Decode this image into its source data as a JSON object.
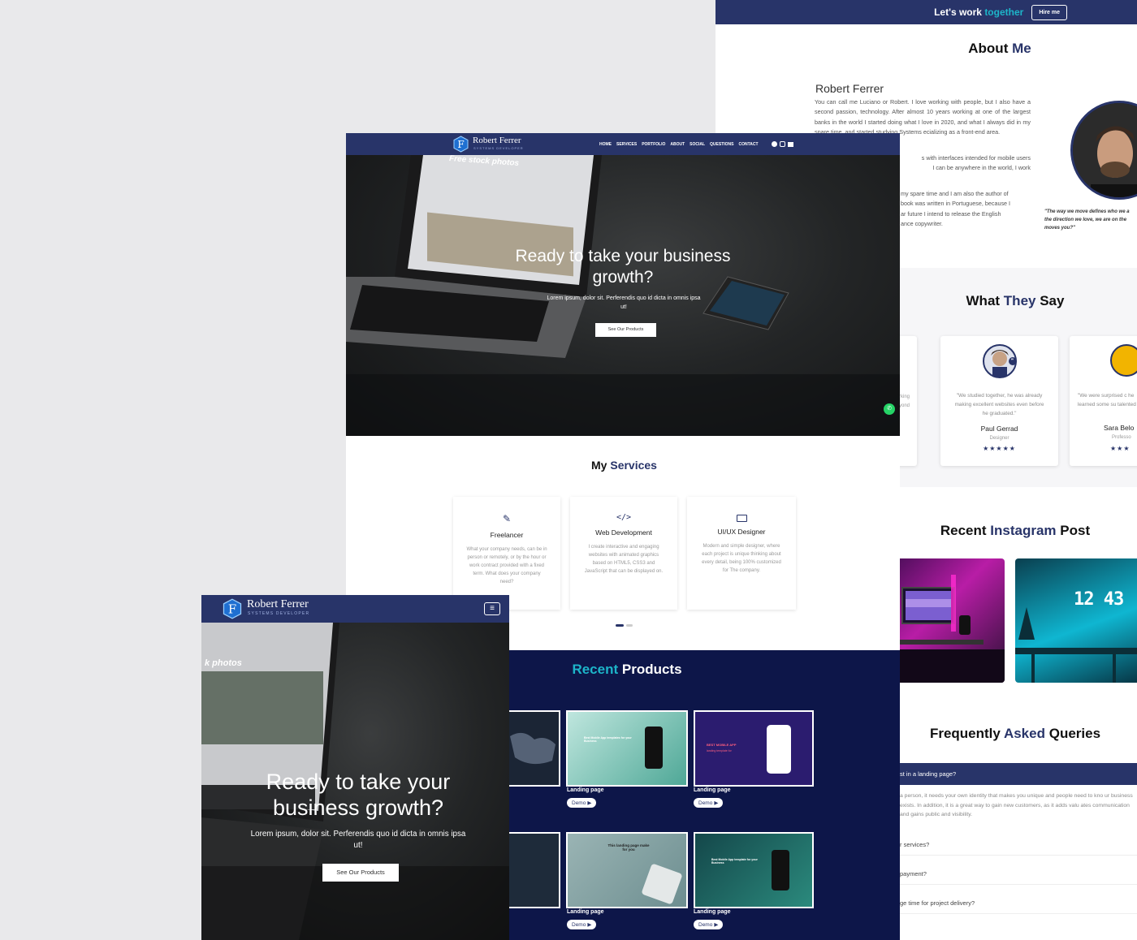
{
  "about_panel": {
    "cta_text": "Let's work",
    "cta_accent": "together",
    "hire_button": "Hire me",
    "about_title_a": "About",
    "about_title_b": "Me",
    "name": "Robert Ferrer",
    "p1": "You can call me Luciano or Robert. I love working with people, but I also have a second passion, technology. After almost 10 years working at one of the largest banks in the world I started doing what I love in 2020, and what I always did in my spare time, and started studying Systems",
    "p1_tail": "ecializing as a front-end area.",
    "p2a": "s with interfaces intended for mobile users",
    "p2b": "I can be anywhere in the world, I work",
    "p3a": "my spare time and I am also the author of",
    "p3b": "book was written in Portuguese, because I",
    "p3c": "ar future I intend to release the English",
    "p3d": "ance copywriter.",
    "quote": "\"The way we move defines who we a the direction we love, we are on the moves you?\"",
    "testimonials_title_a": "What",
    "testimonials_title_b": "They",
    "testimonials_title_c": "Say",
    "t_partial_left_a": "rking",
    "t_partial_left_b": "yond",
    "t1_quote": "\"We studied together, he was already making excellent websites even before he graduated.\"",
    "t1_name": "Paul Gerrad",
    "t1_role": "Designer",
    "t2_quote": "\"We were surprised c he learned some su talented",
    "t2_name": "Sara Belo",
    "t2_role": "Professo",
    "stars": "★★★★★",
    "stars_partial": "★★★",
    "instagram_title_a": "Recent",
    "instagram_title_b": "Instagram",
    "instagram_title_c": "Post",
    "insta_clock": "12 43",
    "faq_title_a": "Frequently",
    "faq_title_b": "Asked",
    "faq_title_c": "Queries",
    "faq_open_q": "st in a landing page?",
    "faq_open_a": "a person, it needs your own identity that makes you unique and people need to kno ur business exists. In addition, it is a great way to gain new customers, as it adds valu ates communication and gains public and visibility.",
    "faq_q2": "r services?",
    "faq_q3": "payment?",
    "faq_q4": "ge time for project delivery?"
  },
  "desktop": {
    "logo_name": "Robert Ferrer",
    "logo_sub": "SYSTEMS DEVELOPER",
    "nav": [
      "HOME",
      "SERVICES",
      "PORTFOLIO",
      "ABOUT",
      "SOCIAL",
      "QUESTIONS",
      "CONTACT"
    ],
    "screen_text": "Free stock photos",
    "hero_title_1": "Ready to take your business",
    "hero_title_2": "growth?",
    "hero_sub_1": "Lorem ipsum, dolor sit. Perferendis quo id dicta in omnis ipsa",
    "hero_sub_2": "ut!",
    "hero_btn": "See Our Products",
    "services_title_a": "My",
    "services_title_b": "Services",
    "services": [
      {
        "title": "Freelancer",
        "desc": "What your company needs, can be in person or remotely, or by the hour or work contract provided with a fixed term. What does your company need?"
      },
      {
        "title": "Web Development",
        "desc": "I create interactive and engaging websites with animated graphics based on HTML5, CSS3 and JavaScript that can be displayed on."
      },
      {
        "title": "UI/UX Designer",
        "desc": "Modern and simple designer, where each project is unique thinking about every detail, being 100% customized for The company."
      }
    ],
    "products_title_a": "Recent",
    "products_title_b": "Products",
    "product_label": "Landing page",
    "demo": "Demo",
    "p1_head": "Best Mobile App templates for your Business",
    "p2_head": "BEST MOBILE APP",
    "p2_sub": "landing template for",
    "p4_head": "This landing page make for you",
    "p5_head": "Best Mobile App template for your Business"
  },
  "mobile": {
    "logo_name": "Robert Ferrer",
    "logo_sub": "SYSTEMS DEVELOPER",
    "screen_text": "k photos",
    "hero_title_1": "Ready to take your",
    "hero_title_2": "business growth?",
    "hero_sub_1": "Lorem ipsum, dolor sit. Perferendis quo id dicta in omnis ipsa",
    "hero_sub_2": "ut!",
    "hero_btn": "See Our Products"
  },
  "colors": {
    "navy": "#283469",
    "accent": "#1db5c9",
    "products_bg": "#0d1649",
    "whatsapp": "#25d366"
  }
}
